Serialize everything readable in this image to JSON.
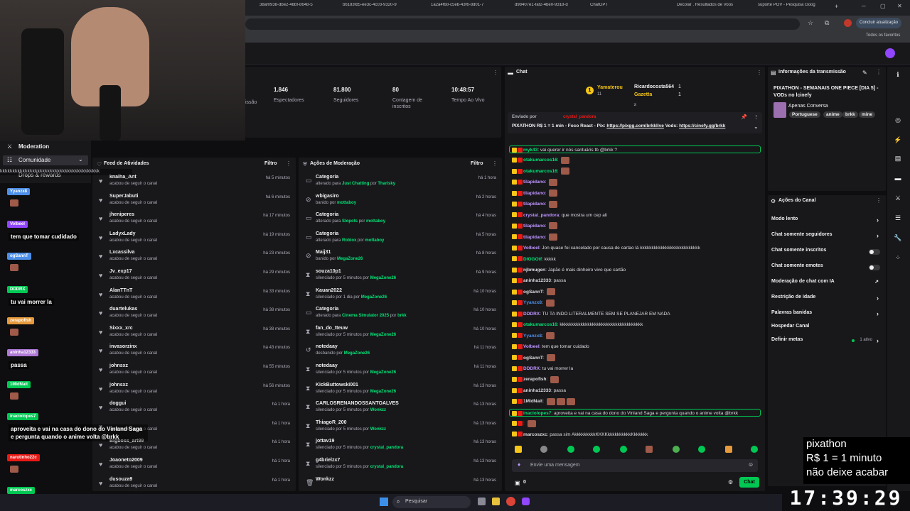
{
  "browser": {
    "tabs": [
      "38af0938-dbe2-48bf-8648-5",
      "b6183fd5-ee3c-4c03-9320-9",
      "1a2a4f68-c5eb-43f6-8d01-7",
      "d98407e1-faf2-4be0-9318-d",
      "ChatGPT",
      "Decolar . Resultados de Voos",
      "suporte POV - Pesquisa Goog"
    ],
    "update_button": "Concluir atualização",
    "bookmarks": "Todos os favoritos"
  },
  "sidebar": {
    "moderation": "Moderation",
    "community": "Comunidade",
    "drops": "Drops & rewards"
  },
  "stats": [
    {
      "value": "1.846",
      "label": "Espectadores"
    },
    {
      "value": "81.800",
      "label": "Seguidores"
    },
    {
      "value": "80",
      "label": "Contagem de inscritos"
    },
    {
      "value": "10:48:57",
      "label": "Tempo Ao Vivo"
    }
  ],
  "stats_partial": "issão",
  "feed": {
    "title": "Feed de Atividades",
    "filter": "Filtro",
    "rows": [
      {
        "name": "knalha_Ant",
        "sub": "acabou de seguir o canal",
        "time": "há 5 minutos"
      },
      {
        "name": "SuperJabuti",
        "sub": "acabou de seguir o canal",
        "time": "há 6 minutos"
      },
      {
        "name": "jheniperes",
        "sub": "acabou de seguir o canal",
        "time": "há 17 minutos"
      },
      {
        "name": "LadyxLady",
        "sub": "acabou de seguir o canal",
        "time": "há 19 minutos"
      },
      {
        "name": "Lxcassilva",
        "sub": "acabou de seguir o canal",
        "time": "há 23 minutos"
      },
      {
        "name": "Jv_exp17",
        "sub": "acabou de seguir o canal",
        "time": "há 29 minutos"
      },
      {
        "name": "AlanTTnT",
        "sub": "acabou de seguir o canal",
        "time": "há 33 minutos"
      },
      {
        "name": "duartelukas",
        "sub": "acabou de seguir o canal",
        "time": "há 38 minutos"
      },
      {
        "name": "Sixxx_xrc",
        "sub": "acabou de seguir o canal",
        "time": "há 38 minutos"
      },
      {
        "name": "invasorzinx",
        "sub": "acabou de seguir o canal",
        "time": "há 43 minutos"
      },
      {
        "name": "johnsxz",
        "sub": "acabou de seguir o canal",
        "time": "há 55 minutos"
      },
      {
        "name": "johnsxz",
        "sub": "acabou de seguir o canal",
        "time": "há 56 minutos"
      },
      {
        "name": "doggui",
        "sub": "acabou de seguir o canal",
        "time": "há 1 hora"
      },
      {
        "name": "",
        "sub": "acabou de seguir o canal",
        "time": "há 1 hora"
      },
      {
        "name": "Bigboss_art99",
        "sub": "acabou de seguir o canal",
        "time": "há 1 hora"
      },
      {
        "name": "Joaoneto2009",
        "sub": "acabou de seguir o canal",
        "time": "há 1 hora"
      },
      {
        "name": "dusouza9",
        "sub": "acabou de seguir o canal",
        "time": "há 1 hora"
      }
    ]
  },
  "modactions": {
    "title": "Ações de Moderação",
    "filter": "Filtro",
    "rows": [
      {
        "icon": "category-icon",
        "name": "Categoria",
        "pre": "alterado para ",
        "g1": "Just Chatting",
        "mid": " por ",
        "g2": "Tharisky",
        "time": "há 1 hora"
      },
      {
        "icon": "ban-icon",
        "name": "wbigasiro",
        "pre": "banido por ",
        "g1": "mottaboy",
        "mid": "",
        "g2": "",
        "time": "há 2 horas"
      },
      {
        "icon": "category-icon",
        "name": "Categoria",
        "pre": "alterado para ",
        "g1": "Slopots",
        "mid": " por ",
        "g2": "mottaboy",
        "time": "há 4 horas"
      },
      {
        "icon": "category-icon",
        "name": "Categoria",
        "pre": "alterado para ",
        "g1": "Roblox",
        "mid": " por ",
        "g2": "mottaboy",
        "time": "há 5 horas"
      },
      {
        "icon": "ban-icon",
        "name": "Maij31",
        "pre": "banido por ",
        "g1": "MegaZone26",
        "mid": "",
        "g2": "",
        "time": "há 8 horas"
      },
      {
        "icon": "timeout-icon",
        "name": "souza10p1",
        "pre": "silenciado por 5 minutos por ",
        "g1": "MegaZone26",
        "mid": "",
        "g2": "",
        "time": "há 9 horas"
      },
      {
        "icon": "timeout-icon",
        "name": "Kauan2022",
        "pre": "silenciado por 1 dia por ",
        "g1": "MegaZone26",
        "mid": "",
        "g2": "",
        "time": "há 10 horas"
      },
      {
        "icon": "category-icon",
        "name": "Categoria",
        "pre": "alterado para ",
        "g1": "Cinema Simulator 2025",
        "mid": " por ",
        "g2": "brkk",
        "time": "há 10 horas"
      },
      {
        "icon": "timeout-icon",
        "name": "fan_do_tteuw",
        "pre": "silenciado por 5 minutos por ",
        "g1": "MegaZone26",
        "mid": "",
        "g2": "",
        "time": "há 10 horas"
      },
      {
        "icon": "unban-icon",
        "name": "notedaay",
        "pre": "desbanido por ",
        "g1": "MegaZone26",
        "mid": "",
        "g2": "",
        "time": "há 11 horas"
      },
      {
        "icon": "timeout-icon",
        "name": "notedaay",
        "pre": "silenciado por 5 minutos por ",
        "g1": "MegaZone26",
        "mid": "",
        "g2": "",
        "time": "há 11 horas"
      },
      {
        "icon": "timeout-icon",
        "name": "KickButtowski001",
        "pre": "silenciado por 5 minutos por ",
        "g1": "MegaZone26",
        "mid": "",
        "g2": "",
        "time": "há 13 horas"
      },
      {
        "icon": "timeout-icon",
        "name": "CARLOSRENANDOSSANTOALVES",
        "pre": "silenciado por 5 minutos por ",
        "g1": "Wonkzz",
        "mid": "",
        "g2": "",
        "time": "há 13 horas"
      },
      {
        "icon": "timeout-icon",
        "name": "ThiagoR_200",
        "pre": "silenciado por 5 minutos por ",
        "g1": "Wonkzz",
        "mid": "",
        "g2": "",
        "time": "há 13 horas"
      },
      {
        "icon": "timeout-icon",
        "name": "jottav19",
        "pre": "silenciado por 5 minutos por ",
        "g1": "crystal_pandora",
        "mid": "",
        "g2": "",
        "time": "há 13 horas"
      },
      {
        "icon": "timeout-icon",
        "name": "g4brielzx7",
        "pre": "silenciado por 5 minutos por ",
        "g1": "crystal_pandora",
        "mid": "",
        "g2": "",
        "time": "há 13 horas"
      },
      {
        "icon": "trash-icon",
        "name": "Wonkzz",
        "pre": "",
        "g1": "",
        "mid": "",
        "g2": "",
        "time": "há 13 horas"
      }
    ]
  },
  "chat": {
    "title": "Chat",
    "leaders": [
      {
        "name": "Yamaterou",
        "count": "11"
      },
      {
        "name": "Ricardocosta564",
        "count": "1"
      },
      {
        "name": "Gazetta",
        "count": "1"
      }
    ],
    "pinned_by_label": "Enviado por",
    "pinned_user": "crystal_pandora",
    "pinned_text": "PIXATHON R$ 1 = 1 min - Foco React - Pix: ",
    "pinned_link1": "https://pixgg.com/brkklive",
    "pinned_mid": " Vods: ",
    "pinned_link2": "https://cinefy.gg/brkk",
    "messages": [
      {
        "user": "myk43",
        "color": "#00e676",
        "text": "vai querer ir nós santuáris tb @brkk ?",
        "hl": true
      },
      {
        "user": "otakumarcos16",
        "color": "#00e676",
        "text": "",
        "em": 1
      },
      {
        "user": "otakumarcos16",
        "color": "#00e676",
        "text": "",
        "em": 1
      },
      {
        "user": "tilapidano",
        "color": "#bf94ff",
        "text": "",
        "em": 1
      },
      {
        "user": "tilapidano",
        "color": "#bf94ff",
        "text": "",
        "em": 1
      },
      {
        "user": "tilapidano",
        "color": "#bf94ff",
        "text": "",
        "em": 1
      },
      {
        "user": "crystal_pandora",
        "color": "#bf94ff",
        "text": "que mostra um cep ali"
      },
      {
        "user": "tilapidano",
        "color": "#bf94ff",
        "text": "",
        "em": 1
      },
      {
        "user": "tilapidano",
        "color": "#bf94ff",
        "text": "",
        "em": 1
      },
      {
        "user": "Volbeel",
        "color": "#bf94ff",
        "text": "Jon quase foi cancelado por causa de cartao lá kkkkkkkkkkkkkkkkkkkkkkkkkk"
      },
      {
        "user": "DIOGOtf",
        "color": "#00e676",
        "text": "kkkkk"
      },
      {
        "user": "njbmugen",
        "color": "#dedee3",
        "text": "Japão é mais dinheiro vivo que cartão"
      },
      {
        "user": "aninha12333",
        "color": "#dedee3",
        "text": "passa"
      },
      {
        "user": "ogSannT",
        "color": "#dedee3",
        "text": "",
        "em": 1
      },
      {
        "user": "Yyanzx8",
        "color": "#4d8fe8",
        "text": "",
        "em": 1
      },
      {
        "user": "DDDRX",
        "color": "#bf94ff",
        "text": "TU TA INDO LITERALMENTE SEM SE PLANEJAR EM NADA"
      },
      {
        "user": "otakumarcos16",
        "color": "#00e676",
        "text": "kkkkkkkkkkkkkkkkkkkkkkkkkkkkkkkkkkkk"
      },
      {
        "user": "Yyanzx8",
        "color": "#4d8fe8",
        "text": "",
        "em": 1
      },
      {
        "user": "Volbeel",
        "color": "#bf94ff",
        "text": "tem que tomar cuidado"
      },
      {
        "user": "ogSannT",
        "color": "#dedee3",
        "text": "",
        "em": 1
      },
      {
        "user": "DDDRX",
        "color": "#bf94ff",
        "text": "tu vai morrer la"
      },
      {
        "user": "zerapofish",
        "color": "#dedee3",
        "text": "",
        "em": 1
      },
      {
        "user": "aninha12333",
        "color": "#dedee3",
        "text": "passa"
      },
      {
        "user": "1MidNait",
        "color": "#dedee3",
        "text": "",
        "em": 3
      },
      {
        "user": "inacioIopes7",
        "color": "#00e676",
        "text": "aproveita e vai na casa do dono do Vinland Saga e pergunta quando o anime volta @brkk",
        "hl": true
      },
      {
        "user": "",
        "color": "#e91916",
        "text": "",
        "em": 1
      },
      {
        "user": "marcoszxc",
        "color": "#dedee3",
        "text": "passa sim AkkkkkkkkkKKKKkkkkkkkkkkKkkkkkk"
      }
    ],
    "input_placeholder": "Envie uma mensagem",
    "points": "0",
    "send": "Chat"
  },
  "stream_info": {
    "title_label": "Informações da transmissão",
    "stream_title": "PIXATHON - SEMANAIS ONE PIECE [DIA 5] - VODs no lcinefy",
    "category": "Apenas Conversa",
    "tags": [
      "Portuguese",
      "anime",
      "brkk",
      "mine"
    ]
  },
  "channel_actions": {
    "title": "Ações do Canal",
    "items": [
      {
        "label": "Modo lento",
        "ctrl": "chevron"
      },
      {
        "label": "Chat somente seguidores",
        "ctrl": "chevron"
      },
      {
        "label": "Chat somente inscritos",
        "ctrl": "toggle"
      },
      {
        "label": "Chat somente emotes",
        "ctrl": "toggle"
      },
      {
        "label": "Moderação de chat com IA",
        "ctrl": "external"
      },
      {
        "label": "Restrição de idade",
        "ctrl": "chevron"
      },
      {
        "label": "Palavras banidas",
        "ctrl": "chevron"
      },
      {
        "label": "Hospedar Canal",
        "ctrl": "none"
      },
      {
        "label": "Definir metas",
        "ctrl": "meta"
      }
    ],
    "meta_status": "1 ativo"
  },
  "overlay": {
    "chat": [
      {
        "tag": "Yyanzx8",
        "tagcolor": "#4d8fe8",
        "msg": ""
      },
      {
        "tag": "Volbeel",
        "tagcolor": "#9146ff",
        "msg": "tem que tomar cudidado"
      },
      {
        "tag": "ogSannT",
        "tagcolor": "#4d8fe8",
        "msg": ""
      },
      {
        "tag": "DDDRX",
        "tagcolor": "#00c853",
        "msg": "tu vai morrer la"
      },
      {
        "tag": "zerapofish",
        "tagcolor": "#e69a3c",
        "msg": ""
      },
      {
        "tag": "aninha12333",
        "tagcolor": "#b07ad6",
        "msg": "passa"
      },
      {
        "tag": "1MidNait",
        "tagcolor": "#00c853",
        "msg": ""
      },
      {
        "tag": "inacioIopes7",
        "tagcolor": "#00c853",
        "msg": "aproveita e vai na casa do dono do Vinland Saga e pergunta quando o anime volta @brkk"
      },
      {
        "tag": "narutinho22c",
        "tagcolor": "#e91916",
        "msg": ""
      },
      {
        "tag": "marcoszxc",
        "tagcolor": "#00c853",
        "msg": "passa sim AkkkkkkkkkKKKKkkkkkkkkkkKkkkkkk"
      }
    ],
    "kk_line": "kkkkkkkkkkkkkkkkkkkkkkkkkkkkkkkkkkkkkkkk",
    "pix_lines": [
      "pixathon",
      "R$ 1 = 1 minuto",
      "não deixe acabar"
    ],
    "clock": "17:39:29"
  },
  "taskbar": {
    "search": "Pesquisar"
  }
}
